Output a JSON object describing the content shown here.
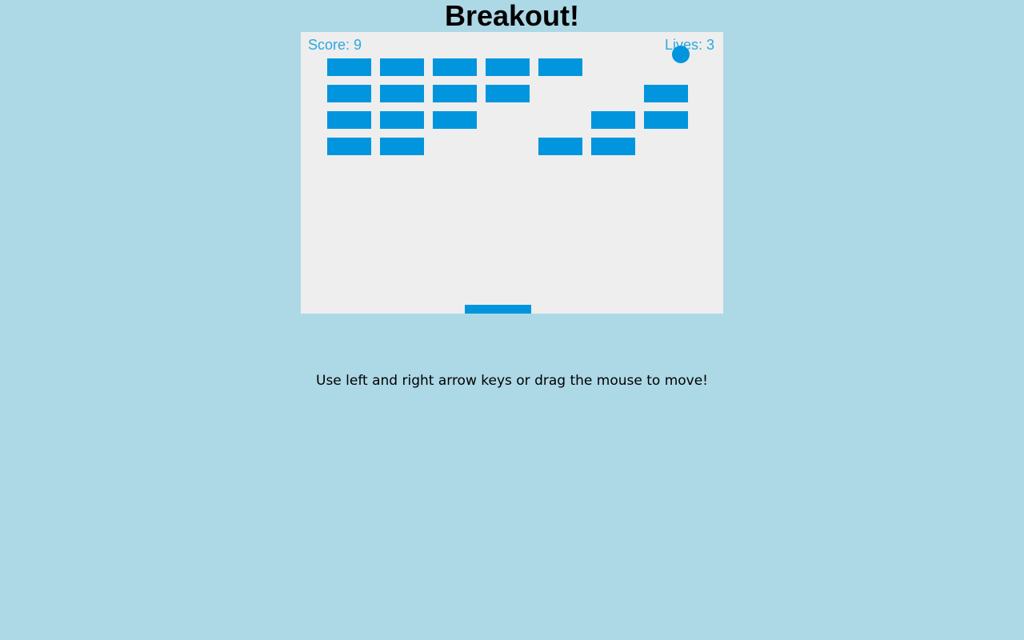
{
  "page": {
    "title": "Breakout!",
    "instructions": "Use left and right arrow keys or drag the mouse to move!"
  },
  "hud": {
    "score_text": "Score: 9",
    "lives_text": "Lives: 3"
  },
  "colors": {
    "background": "#add8e6",
    "canvas": "#eeeeee",
    "brick": "#0095dd",
    "ball": "#0095dd",
    "paddle": "#0095dd",
    "hud_text": "#29a9e0"
  },
  "bricks": {
    "rows": 4,
    "columns": 7,
    "present": [
      [
        true,
        true,
        true,
        true,
        true,
        false,
        false
      ],
      [
        true,
        true,
        true,
        true,
        false,
        false,
        true
      ],
      [
        true,
        true,
        true,
        false,
        false,
        true,
        true
      ],
      [
        true,
        true,
        false,
        false,
        true,
        true,
        false
      ]
    ]
  }
}
